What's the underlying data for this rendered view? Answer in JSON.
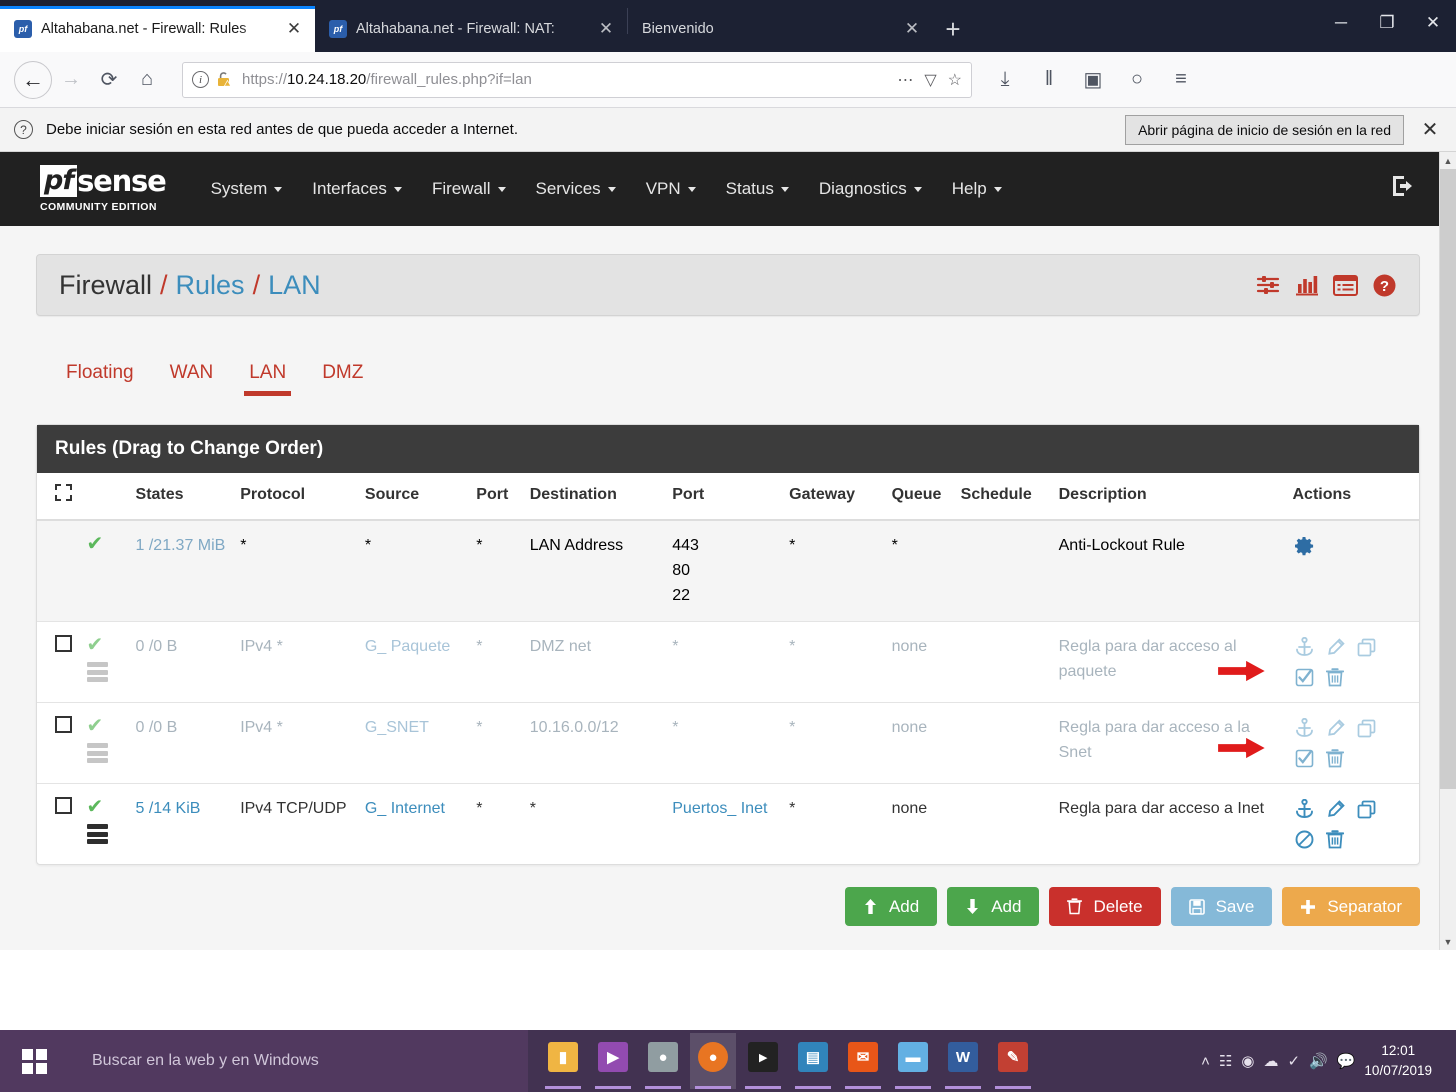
{
  "browser": {
    "tabs": [
      {
        "title": "Altahabana.net - Firewall: Rules",
        "favicon": "pf",
        "active": true,
        "close": "✕"
      },
      {
        "title": "Altahabana.net - Firewall: NAT:",
        "favicon": "pf",
        "active": false,
        "close": "✕"
      },
      {
        "title": "Bienvenido",
        "favicon": "",
        "active": false,
        "close": "✕"
      }
    ],
    "new_tab_label": "+",
    "window_controls": {
      "minimize": "─",
      "maximize": "❐",
      "close": "✕"
    },
    "nav": {
      "back": "←",
      "forward": "→",
      "reload": "⟳",
      "home": "⌂"
    },
    "url": {
      "scheme": "https://",
      "host": "10.24.18.20",
      "path": "/firewall_rules.php?if=lan",
      "info_icon": "i",
      "lock_icon": "warning-lock"
    },
    "url_icons": {
      "more": "⋯",
      "reader": "▽",
      "bookmark": "☆"
    },
    "toolbar_right": {
      "download": "⤓",
      "library": "‖",
      "sidebar": "▣",
      "account": "○",
      "menu": "≡"
    }
  },
  "notification": {
    "icon": "?",
    "message": "Debe iniciar sesión en esta red antes de que pueda acceder a Internet.",
    "button": "Abrir página de inicio de sesión en la red",
    "close": "✕"
  },
  "pfsense": {
    "logo": {
      "pf": "pf",
      "sense": "sense",
      "subtitle": "COMMUNITY EDITION"
    },
    "menu": [
      "System",
      "Interfaces",
      "Firewall",
      "Services",
      "VPN",
      "Status",
      "Diagnostics",
      "Help"
    ],
    "logout_icon": "logout-icon",
    "breadcrumb": {
      "root": "Firewall",
      "mid": "Rules",
      "leaf": "LAN",
      "separator": "/"
    },
    "header_icons": [
      "sliders-icon",
      "chart-icon",
      "list-icon",
      "help-icon"
    ],
    "tabs": [
      {
        "label": "Floating",
        "active": false
      },
      {
        "label": "WAN",
        "active": false
      },
      {
        "label": "LAN",
        "active": true
      },
      {
        "label": "DMZ",
        "active": false
      }
    ],
    "panel_title": "Rules (Drag to Change Order)",
    "columns": [
      "",
      "",
      "States",
      "Protocol",
      "Source",
      "Port",
      "Destination",
      "Port",
      "Gateway",
      "Queue",
      "Schedule",
      "Description",
      "Actions"
    ],
    "rows": [
      {
        "selectable": false,
        "status": "pass",
        "traffic": "none",
        "states": "1 /21.37 MiB",
        "protocol": "*",
        "source": "*",
        "source_is_link": false,
        "src_port": "*",
        "destination": "LAN Address",
        "destination_is_link": false,
        "dst_port": "443 80 22",
        "gateway": "*",
        "queue": "*",
        "schedule": "",
        "description": "Anti-Lockout Rule",
        "actions": [
          "gear-icon"
        ],
        "dim": false,
        "marker": false
      },
      {
        "selectable": true,
        "status": "pass",
        "traffic": "light",
        "states": "0 /0 B",
        "protocol": "IPv4 *",
        "source": "G_ Paquete",
        "source_is_link": true,
        "src_port": "*",
        "destination": "DMZ net",
        "destination_is_link": false,
        "dst_port": "*",
        "gateway": "*",
        "queue": "none",
        "schedule": "",
        "description": "Regla para dar acceso al paquete",
        "actions": [
          "anchor-icon",
          "pencil-icon",
          "copy-icon",
          "check-square-icon",
          "trash-icon"
        ],
        "dim": true,
        "marker": true
      },
      {
        "selectable": true,
        "status": "pass",
        "traffic": "light",
        "states": "0 /0 B",
        "protocol": "IPv4 *",
        "source": "G_SNET",
        "source_is_link": true,
        "src_port": "*",
        "destination": "10.16.0.0/12",
        "destination_is_link": false,
        "dst_port": "*",
        "gateway": "*",
        "queue": "none",
        "schedule": "",
        "description": "Regla para dar acceso a la Snet",
        "actions": [
          "anchor-icon",
          "pencil-icon",
          "copy-icon",
          "check-square-icon",
          "trash-icon"
        ],
        "dim": true,
        "marker": true
      },
      {
        "selectable": true,
        "status": "pass",
        "traffic": "dark",
        "states": "5 /14 KiB",
        "protocol": "IPv4 TCP/UDP",
        "source": "G_ Internet",
        "source_is_link": true,
        "src_port": "*",
        "destination": "*",
        "destination_is_link": false,
        "dst_port": "Puertos_ Inet",
        "dst_port_is_link": true,
        "gateway": "*",
        "queue": "none",
        "schedule": "",
        "description": "Regla para dar acceso a Inet",
        "actions": [
          "anchor-icon",
          "pencil-icon",
          "copy-icon",
          "ban-icon",
          "trash-icon"
        ],
        "dim": false,
        "marker": false
      }
    ],
    "buttons": [
      {
        "label": "Add",
        "icon": "arrow-up-icon",
        "color": "#4ca64c",
        "style": "btn-green"
      },
      {
        "label": "Add",
        "icon": "arrow-down-icon",
        "color": "#4ca64c",
        "style": "btn-green"
      },
      {
        "label": "Delete",
        "icon": "trash-icon",
        "color": "#c9302c",
        "style": "btn-red"
      },
      {
        "label": "Save",
        "icon": "save-icon",
        "color": "#85b9d8",
        "style": "btn-blue"
      },
      {
        "label": "Separator",
        "icon": "plus-icon",
        "color": "#eda94c",
        "style": "btn-orange"
      }
    ],
    "legend_icon": "info-icon",
    "colors": {
      "accent_red": "#c0392b",
      "link_blue": "#3c8dbc",
      "pass_green": "#5cb85c",
      "navbar_dark": "#212121"
    }
  },
  "taskbar": {
    "start_icon": "windows-logo-icon",
    "search_placeholder": "Buscar en la web y en Windows",
    "apps": [
      {
        "name": "file-explorer-icon",
        "glyph": "▰",
        "color": "#f0b23c",
        "running": true,
        "active": false
      },
      {
        "name": "media-player-icon",
        "glyph": "▶",
        "color": "#8e44ad",
        "running": true,
        "active": false
      },
      {
        "name": "disk-tool-icon",
        "glyph": "●",
        "color": "#7f8c8d",
        "running": true,
        "active": false
      },
      {
        "name": "firefox-icon",
        "glyph": "●",
        "color": "#e8701a",
        "running": true,
        "active": true
      },
      {
        "name": "terminal-icon",
        "glyph": "▸",
        "color": "#1a1a1a",
        "running": true,
        "active": false
      },
      {
        "name": "remote-desktop-icon",
        "glyph": "▤",
        "color": "#2980b9",
        "running": true,
        "active": false
      },
      {
        "name": "mail-icon",
        "glyph": "✉",
        "color": "#e8500f",
        "running": true,
        "active": false
      },
      {
        "name": "notes-icon",
        "glyph": "▬",
        "color": "#5dade2",
        "running": true,
        "active": false
      },
      {
        "name": "word-icon",
        "glyph": "W",
        "color": "#2b579a",
        "running": true,
        "active": false
      },
      {
        "name": "paint-icon",
        "glyph": "✎",
        "color": "#e74c3c",
        "running": true,
        "active": false
      }
    ],
    "tray": {
      "expand": "˄",
      "icons": [
        "network-icon",
        "antivirus-icon",
        "onedrive-icon",
        "usb-icon",
        "volume-icon",
        "action-center-icon"
      ]
    },
    "clock": {
      "time": "12:01",
      "date": "10/07/2019"
    }
  }
}
